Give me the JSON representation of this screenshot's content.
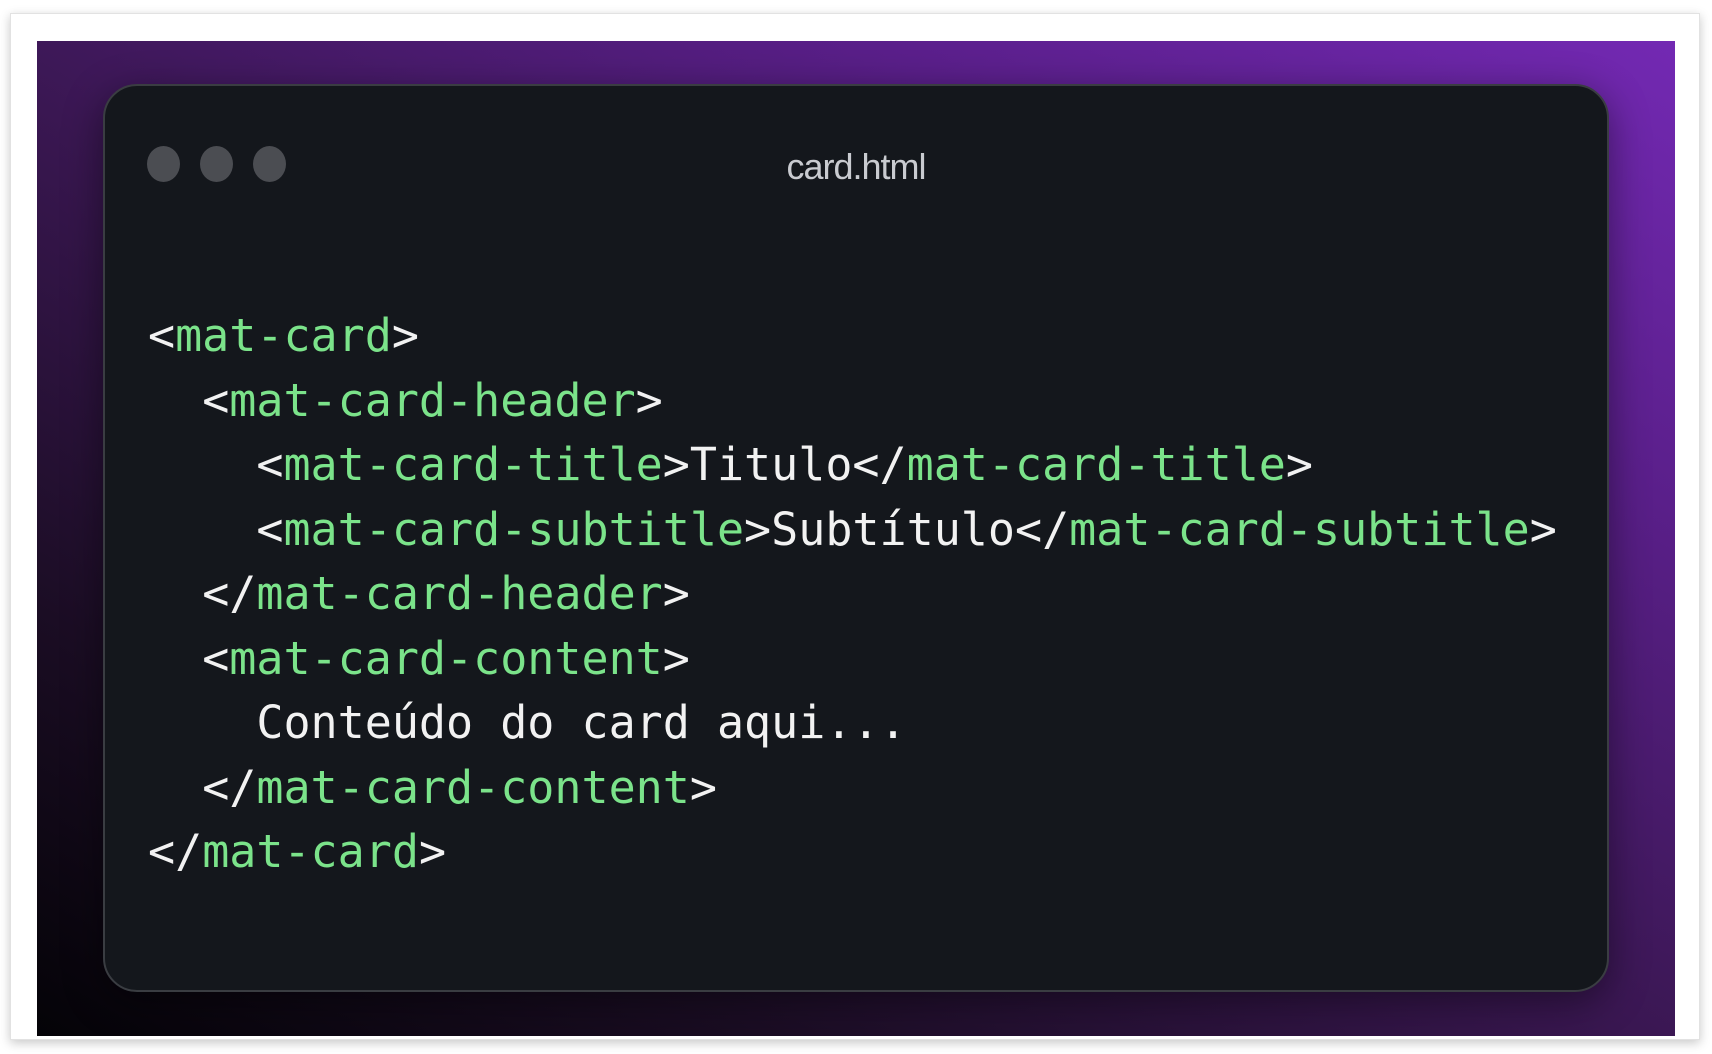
{
  "window": {
    "title": "card.html",
    "dots": [
      "window-dot",
      "window-dot",
      "window-dot"
    ]
  },
  "colors": {
    "tag": "#7be38a",
    "punctuation": "#f2f2f2",
    "text": "#f2f2f2",
    "editor_background": "#14171c",
    "window_dot": "#4b4d52",
    "backdrop_gradient": [
      "#040307",
      "#3a1752",
      "#7329b3"
    ]
  },
  "code": {
    "lines": [
      {
        "indent": "",
        "tokens": [
          {
            "type": "punct",
            "text": "<"
          },
          {
            "type": "tag",
            "text": "mat-card"
          },
          {
            "type": "punct",
            "text": ">"
          }
        ]
      },
      {
        "indent": "  ",
        "tokens": [
          {
            "type": "punct",
            "text": "<"
          },
          {
            "type": "tag",
            "text": "mat-card-header"
          },
          {
            "type": "punct",
            "text": ">"
          }
        ]
      },
      {
        "indent": "    ",
        "tokens": [
          {
            "type": "punct",
            "text": "<"
          },
          {
            "type": "tag",
            "text": "mat-card-title"
          },
          {
            "type": "punct",
            "text": ">"
          },
          {
            "type": "text",
            "text": "Titulo"
          },
          {
            "type": "punct",
            "text": "</"
          },
          {
            "type": "tag",
            "text": "mat-card-title"
          },
          {
            "type": "punct",
            "text": ">"
          }
        ]
      },
      {
        "indent": "    ",
        "tokens": [
          {
            "type": "punct",
            "text": "<"
          },
          {
            "type": "tag",
            "text": "mat-card-subtitle"
          },
          {
            "type": "punct",
            "text": ">"
          },
          {
            "type": "text",
            "text": "Subtítulo"
          },
          {
            "type": "punct",
            "text": "</"
          },
          {
            "type": "tag",
            "text": "mat-card-subtitle"
          },
          {
            "type": "punct",
            "text": ">"
          }
        ]
      },
      {
        "indent": "  ",
        "tokens": [
          {
            "type": "punct",
            "text": "</"
          },
          {
            "type": "tag",
            "text": "mat-card-header"
          },
          {
            "type": "punct",
            "text": ">"
          }
        ]
      },
      {
        "indent": "  ",
        "tokens": [
          {
            "type": "punct",
            "text": "<"
          },
          {
            "type": "tag",
            "text": "mat-card-content"
          },
          {
            "type": "punct",
            "text": ">"
          }
        ]
      },
      {
        "indent": "    ",
        "tokens": [
          {
            "type": "text",
            "text": "Conteúdo do card aqui..."
          }
        ]
      },
      {
        "indent": "  ",
        "tokens": [
          {
            "type": "punct",
            "text": "</"
          },
          {
            "type": "tag",
            "text": "mat-card-content"
          },
          {
            "type": "punct",
            "text": ">"
          }
        ]
      },
      {
        "indent": "",
        "tokens": [
          {
            "type": "punct",
            "text": "</"
          },
          {
            "type": "tag",
            "text": "mat-card"
          },
          {
            "type": "punct",
            "text": ">"
          }
        ]
      }
    ]
  }
}
